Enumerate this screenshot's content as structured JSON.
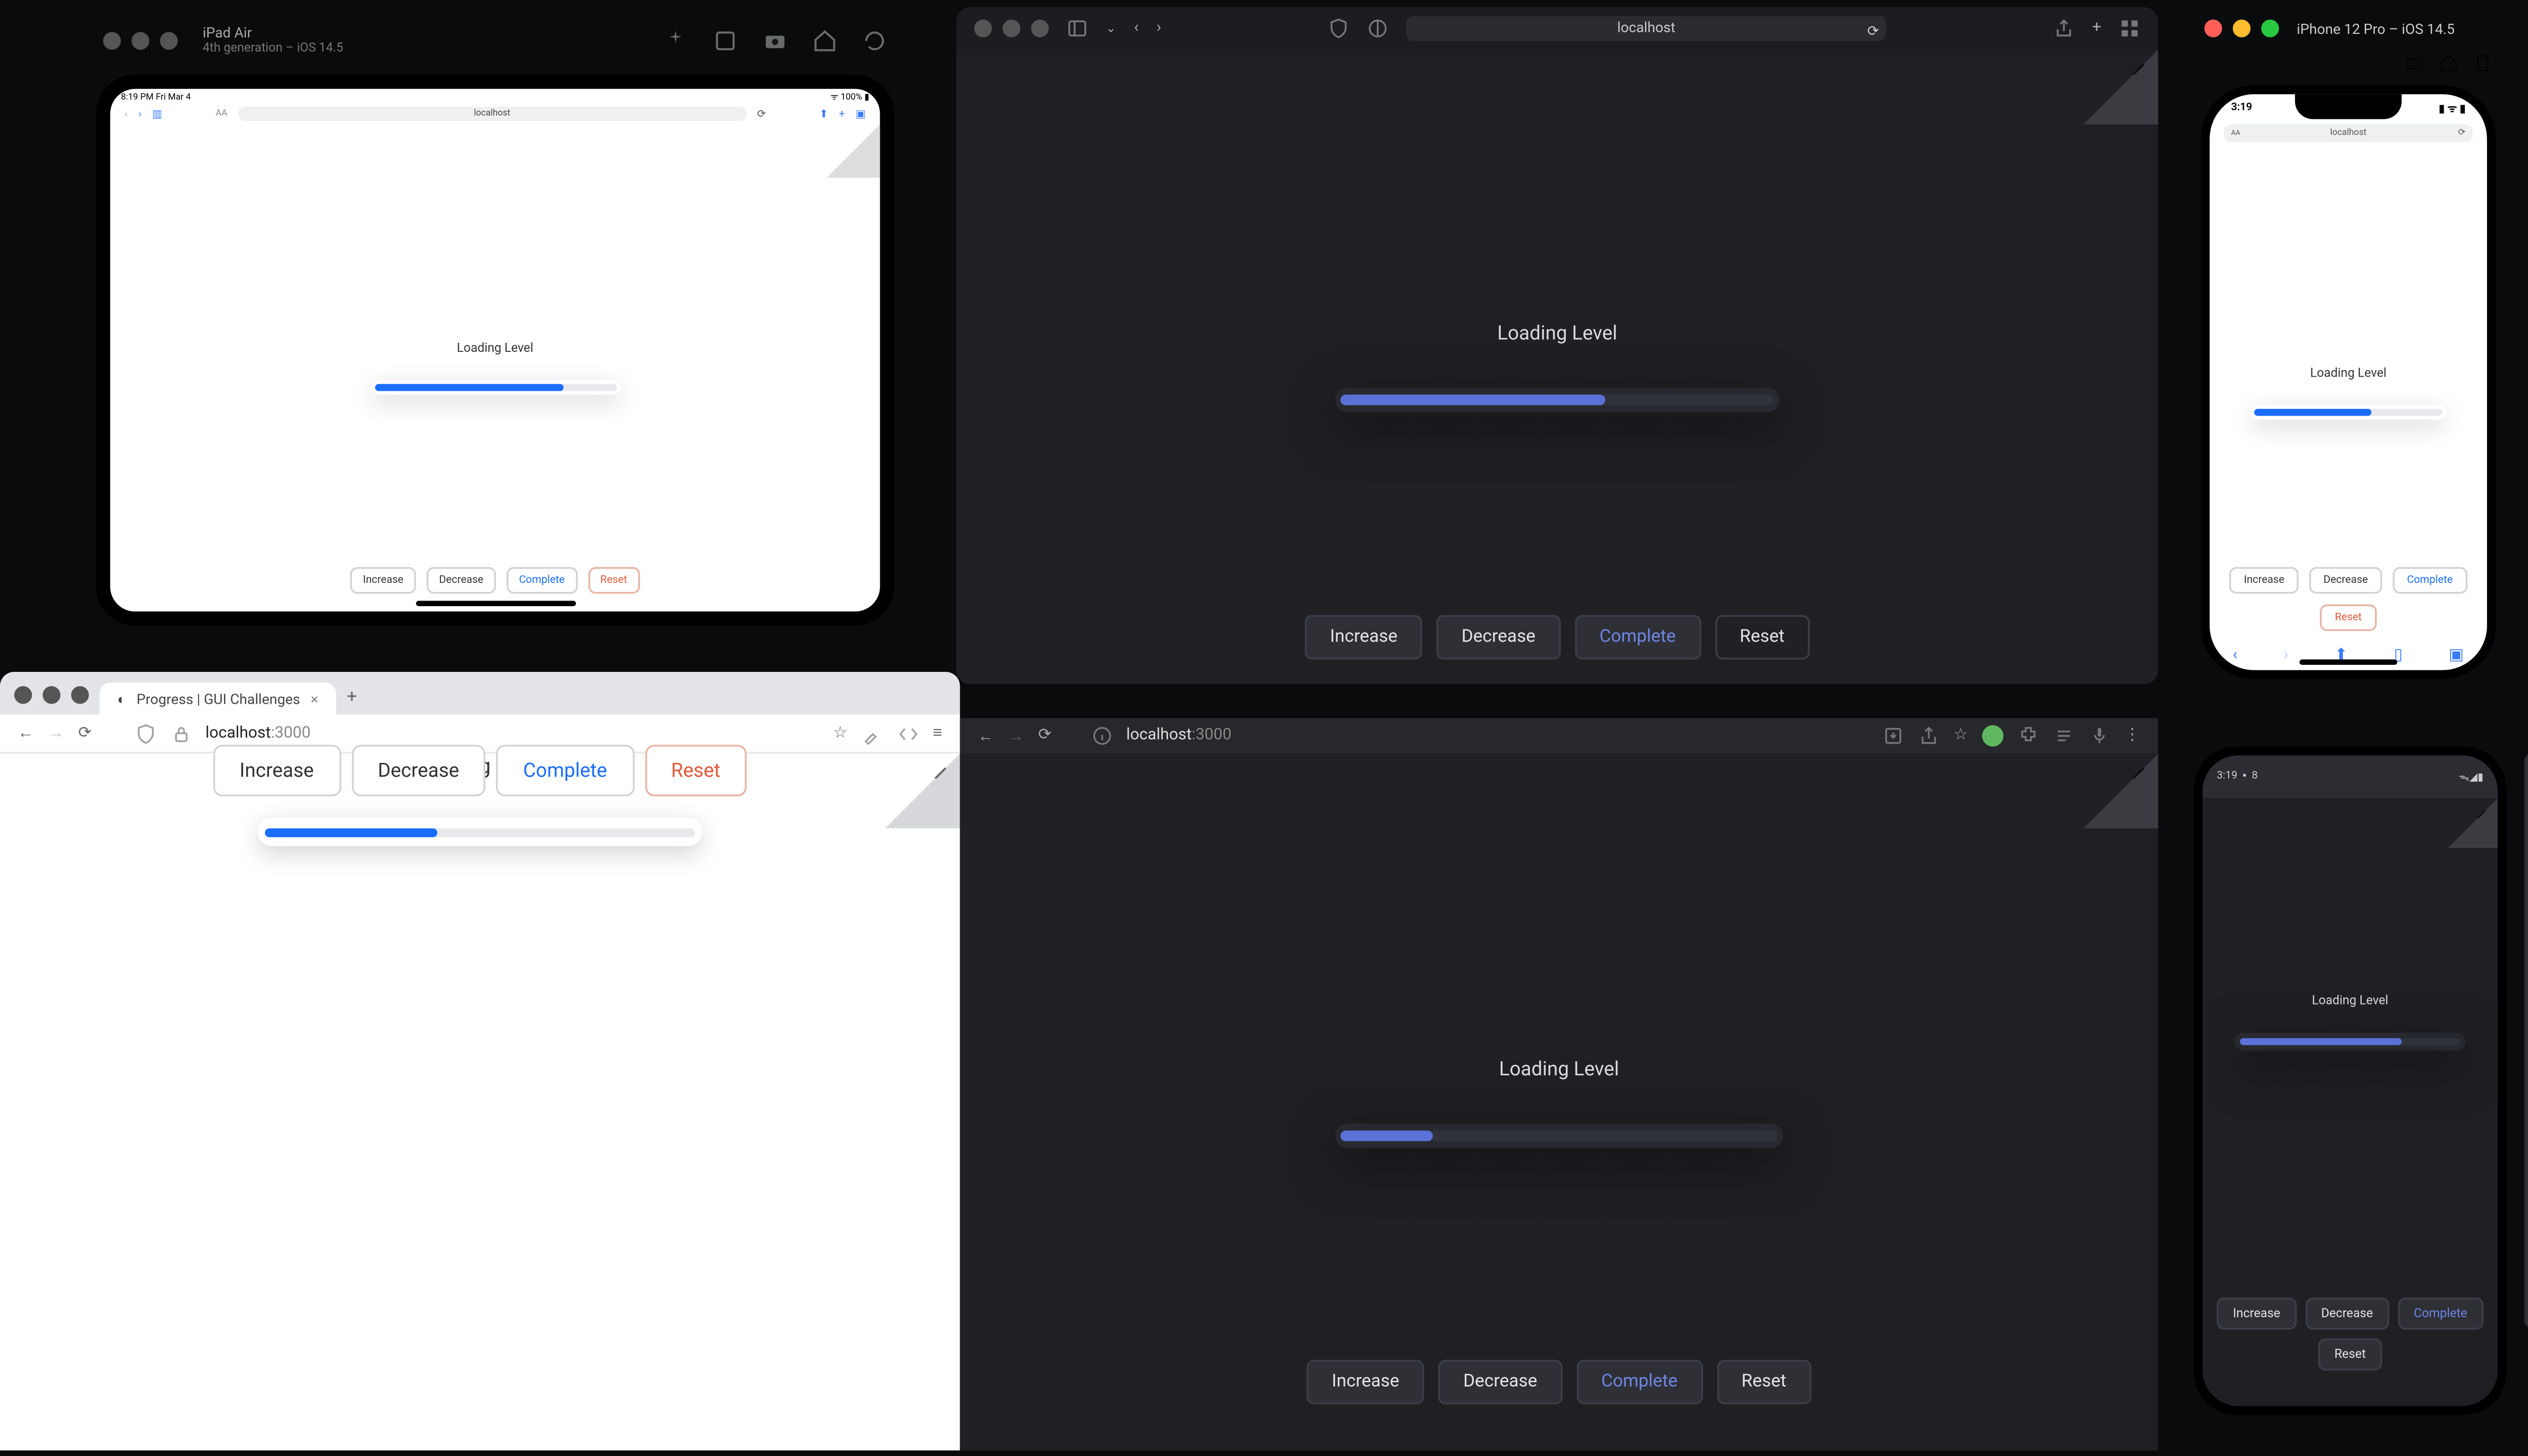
{
  "demo": {
    "label": "Loading Level",
    "buttons": {
      "increase": "Increase",
      "decrease": "Decrease",
      "complete": "Complete",
      "reset": "Reset"
    }
  },
  "ipad": {
    "sim_title": "iPad Air",
    "sim_subtitle": "4th generation – iOS 14.5",
    "status_time": "8:19 PM  Fri Mar 4",
    "status_right": "100%",
    "url": "localhost",
    "progress_pct": 78
  },
  "safari_dark": {
    "url": "localhost",
    "progress_pct": 61
  },
  "iphone": {
    "sim_title": "iPhone 12 Pro – iOS 14.5",
    "status_time": "3:19",
    "url": "localhost",
    "progress_pct": 62
  },
  "browser_light": {
    "tab_title": "Progress | GUI Challenges",
    "host": "localhost",
    "port": ":3000",
    "progress_pct": 40
  },
  "browser_dark": {
    "host": "localhost",
    "port": ":3000",
    "progress_pct": 21
  },
  "android": {
    "status_time": "3:19",
    "status_icon": "8",
    "progress_pct": 73
  }
}
